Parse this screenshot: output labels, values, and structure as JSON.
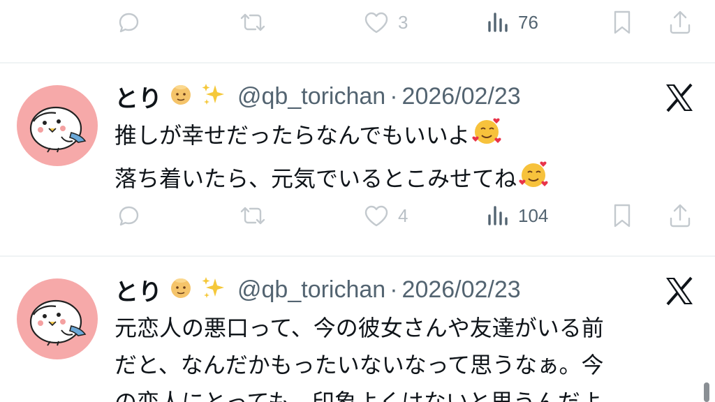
{
  "top_actions": {
    "reply_count": "",
    "retweet_count": "",
    "like_count": "3",
    "view_count": "76"
  },
  "tweets": [
    {
      "display_name": "とり",
      "handle": "@qb_torichan",
      "separator": "·",
      "date": "2026/02/23",
      "lines": [
        "推しが幸せだったらなんでもいいよ",
        "落ち着いたら、元気でいるとこみせてね"
      ],
      "actions": {
        "like_count": "4",
        "view_count": "104"
      }
    },
    {
      "display_name": "とり",
      "handle": "@qb_torichan",
      "separator": "·",
      "date": "2026/02/23",
      "lines": [
        "元恋人の悪口って、今の彼女さんや友達がいる前",
        "だと、なんだかもったいないなって思うなぁ。今",
        "の恋人にとっても、印象よくはないと思うんだよ"
      ]
    }
  ],
  "colors": {
    "avatar_bg": "#f6a9a9",
    "text_primary": "#0f1419",
    "text_secondary": "#536471",
    "icon_muted": "#c3c9ce"
  },
  "icons": [
    "reply-icon",
    "retweet-icon",
    "like-icon",
    "views-icon",
    "bookmark-icon",
    "share-icon",
    "x-logo-icon",
    "bald-face-emoji",
    "sparkles-emoji",
    "smiling-hearts-emoji"
  ]
}
